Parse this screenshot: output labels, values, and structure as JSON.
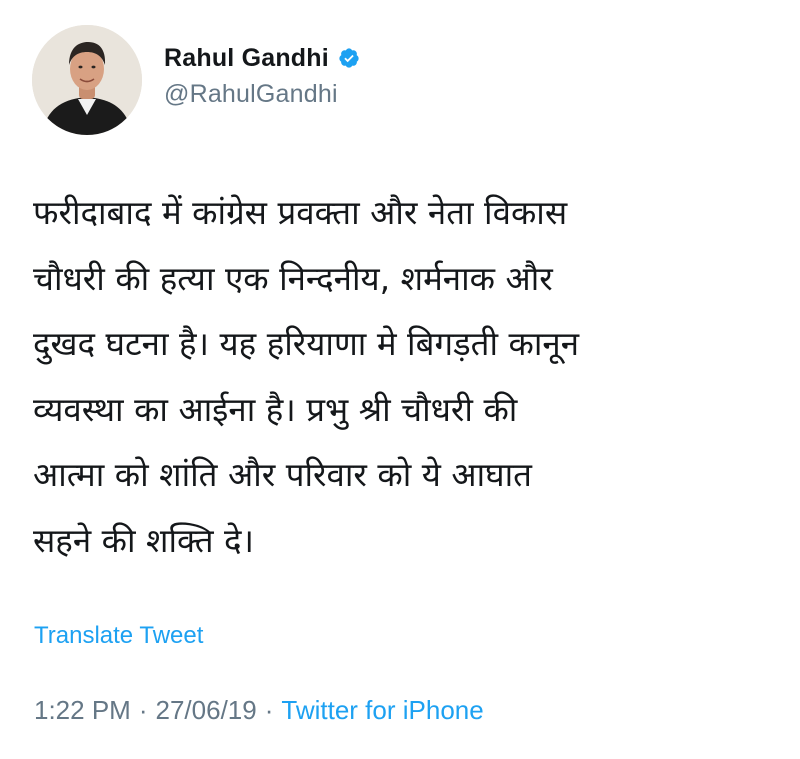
{
  "user": {
    "display_name": "Rahul Gandhi",
    "handle": "@RahulGandhi",
    "verified": true,
    "avatar_icon": "profile-photo"
  },
  "tweet": {
    "lines": [
      "फरीदाबाद में कांग्रेस प्रवक्ता और नेता विकास",
      "चौधरी की हत्या एक निन्दनीय, शर्मनाक और",
      "दुखद घटना है। यह हरियाणा मे बिगड़ती कानून",
      "व्यवस्था का आईना है। प्रभु श्री चौधरी की",
      "आत्मा को शांति और परिवार को ये आघात",
      "सहने की शक्ति दे।"
    ]
  },
  "translate_label": "Translate Tweet",
  "meta": {
    "time": "1:22 PM",
    "separator": "·",
    "date": "27/06/19",
    "source": "Twitter for iPhone"
  },
  "colors": {
    "link": "#1da1f2",
    "secondary_text": "#657786",
    "primary_text": "#14171a",
    "verified_badge": "#1da1f2"
  }
}
